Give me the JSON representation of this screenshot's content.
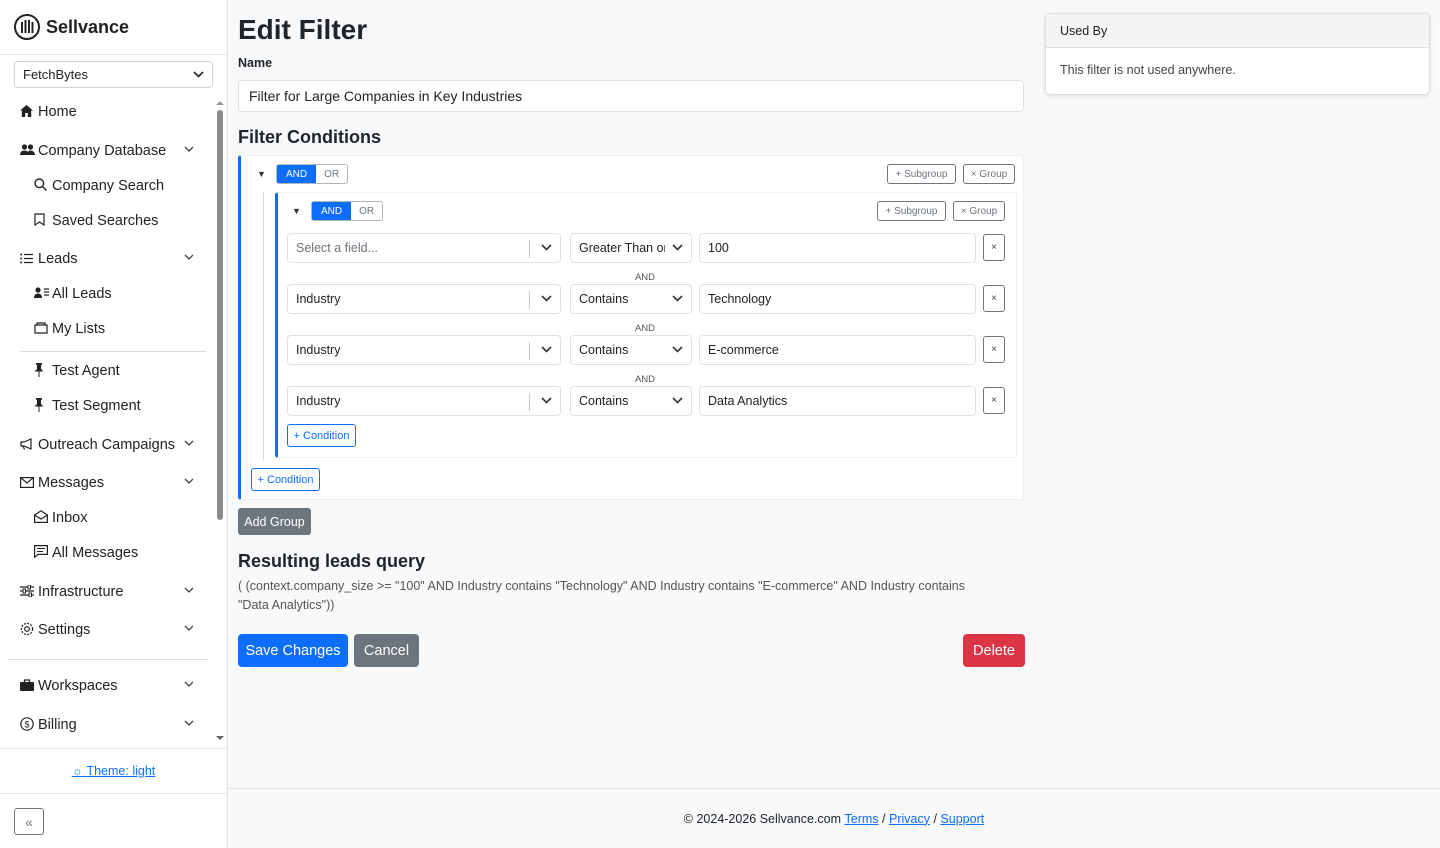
{
  "app": {
    "name": "Sellvance"
  },
  "sidebar": {
    "workspace": "FetchBytes",
    "items": [
      {
        "label": "Home",
        "icon": "house-icon"
      },
      {
        "label": "Company Database",
        "icon": "people-icon"
      },
      {
        "label": "Company Search",
        "icon": "search-icon"
      },
      {
        "label": "Saved Searches",
        "icon": "bookmark-icon"
      },
      {
        "label": "Leads",
        "icon": "list-icon"
      },
      {
        "label": "All Leads",
        "icon": "person-lines-icon"
      },
      {
        "label": "My Lists",
        "icon": "folder-icon"
      },
      {
        "label": "Test Agent",
        "icon": "pin-icon"
      },
      {
        "label": "Test Segment",
        "icon": "pin-icon"
      },
      {
        "label": "Outreach Campaigns",
        "icon": "megaphone-icon"
      },
      {
        "label": "Messages",
        "icon": "envelope-icon"
      },
      {
        "label": "Inbox",
        "icon": "envelope-open-icon"
      },
      {
        "label": "All Messages",
        "icon": "chat-icon"
      },
      {
        "label": "Infrastructure",
        "icon": "sliders-icon"
      },
      {
        "label": "Settings",
        "icon": "gear-icon"
      },
      {
        "label": "Workspaces",
        "icon": "briefcase-icon"
      },
      {
        "label": "Billing",
        "icon": "dollar-icon"
      }
    ],
    "theme_label": "Theme: light"
  },
  "page": {
    "title": "Edit Filter",
    "name_label": "Name",
    "name_value": "Filter for Large Companies in Key Industries",
    "conditions_heading": "Filter Conditions"
  },
  "filter": {
    "and_label": "AND",
    "or_label": "OR",
    "subgroup_label": "+ Subgroup",
    "group_remove_label": "× Group",
    "condition_label": "+ Condition",
    "remove_label": "×",
    "conjunction": "AND",
    "conditions": [
      {
        "field": "Select a field...",
        "operator": "Greater Than or",
        "value": "100"
      },
      {
        "field": "Industry",
        "operator": "Contains",
        "value": "Technology"
      },
      {
        "field": "Industry",
        "operator": "Contains",
        "value": "E-commerce"
      },
      {
        "field": "Industry",
        "operator": "Contains",
        "value": "Data Analytics"
      }
    ],
    "add_group_label": "Add Group"
  },
  "query": {
    "heading": "Resulting leads query",
    "text": "( (context.company_size >= \"100\" AND Industry contains \"Technology\" AND Industry contains \"E-commerce\" AND Industry contains \"Data Analytics\"))"
  },
  "actions": {
    "save": "Save Changes",
    "cancel": "Cancel",
    "delete": "Delete"
  },
  "used_by": {
    "title": "Used By",
    "text": "This filter is not used anywhere."
  },
  "footer": {
    "copyright": "© 2024-2026 Sellvance.com",
    "terms": "Terms",
    "privacy": "Privacy",
    "support": "Support",
    "sep": "/"
  },
  "colors": {
    "primary": "#0d6efd",
    "secondary": "#6c757d",
    "danger": "#dc3545"
  }
}
